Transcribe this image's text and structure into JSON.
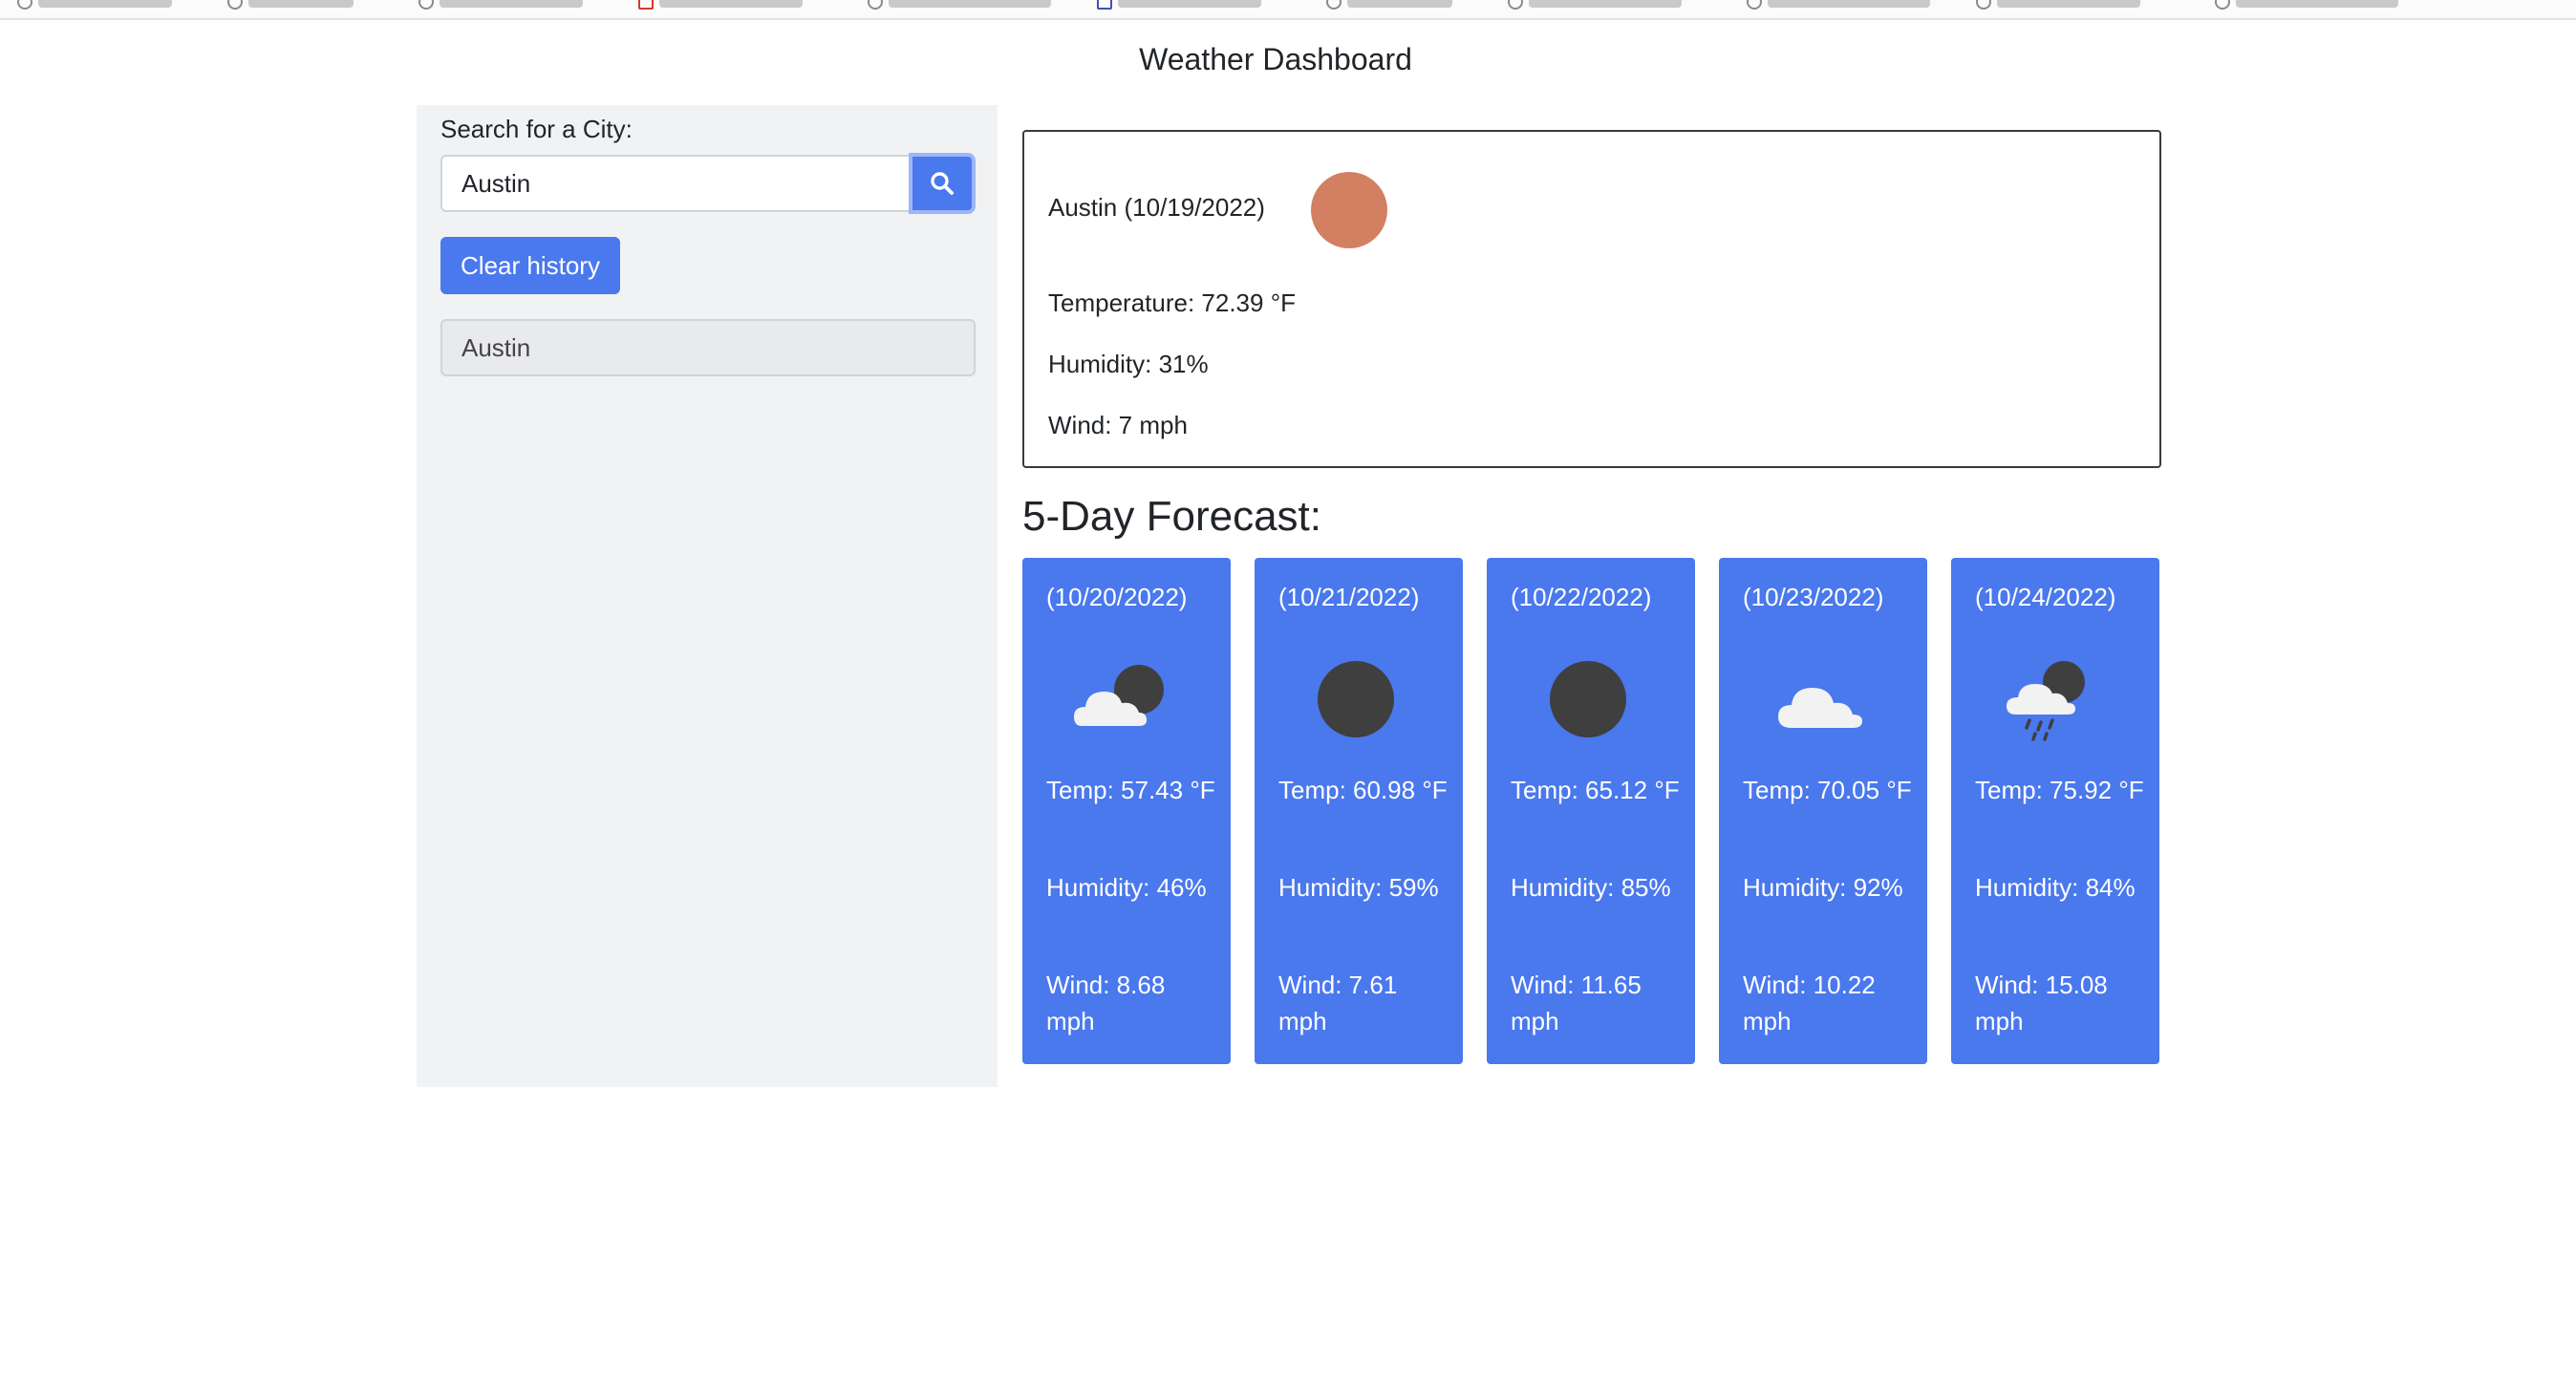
{
  "page_title": "Weather Dashboard",
  "sidebar": {
    "search_label": "Search for a City:",
    "search_value": "Austin",
    "search_icon": "search-icon",
    "clear_label": "Clear history",
    "history": [
      "Austin"
    ]
  },
  "current": {
    "heading": "Austin (10/19/2022)",
    "icon": "clear-day-sun-icon",
    "icon_color": "#d37f62",
    "temperature": "Temperature: 72.39 °F",
    "humidity": "Humidity: 31%",
    "wind": "Wind: 7 mph"
  },
  "forecast": {
    "title": "5-Day Forecast:",
    "accent_color": "#4a78ed",
    "days": [
      {
        "date": "(10/20/2022)",
        "icon": "partly-cloudy-night-icon",
        "temp": "Temp: 57.43 °F",
        "humidity": "Humidity: 46%",
        "wind": "Wind: 8.68 mph"
      },
      {
        "date": "(10/21/2022)",
        "icon": "clear-night-moon-icon",
        "temp": "Temp: 60.98 °F",
        "humidity": "Humidity: 59%",
        "wind": "Wind: 7.61 mph"
      },
      {
        "date": "(10/22/2022)",
        "icon": "clear-night-moon-icon",
        "temp": "Temp: 65.12 °F",
        "humidity": "Humidity: 85%",
        "wind": "Wind: 11.65 mph"
      },
      {
        "date": "(10/23/2022)",
        "icon": "cloud-icon",
        "temp": "Temp: 70.05 °F",
        "humidity": "Humidity: 92%",
        "wind": "Wind: 10.22 mph"
      },
      {
        "date": "(10/24/2022)",
        "icon": "rain-night-icon",
        "temp": "Temp: 75.92 °F",
        "humidity": "Humidity: 84%",
        "wind": "Wind: 15.08 mph"
      }
    ]
  }
}
